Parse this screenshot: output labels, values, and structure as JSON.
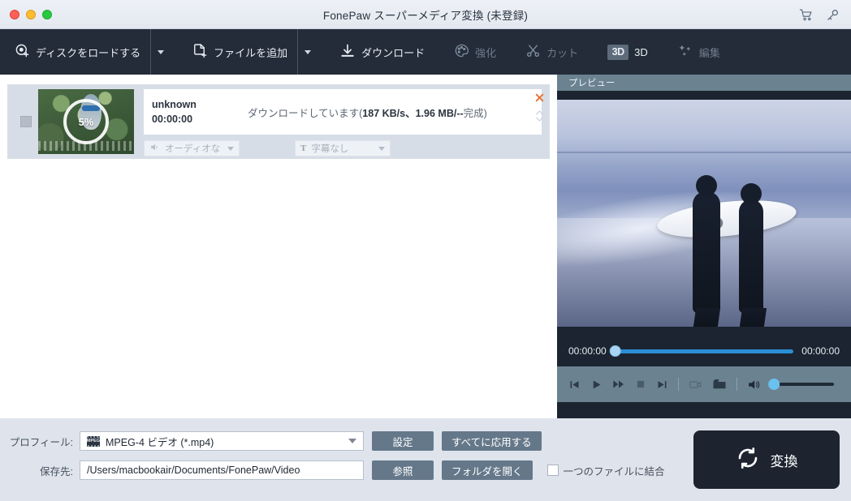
{
  "window": {
    "title": "FonePaw スーパーメディア変換 (未登録)",
    "controls": [
      "close",
      "minimize",
      "maximize"
    ],
    "right_icons": [
      "cart-icon",
      "key-icon"
    ]
  },
  "toolbar": {
    "items": [
      {
        "label": "ディスクをロードする",
        "icon": "load-disc-icon",
        "has_caret": true,
        "disabled": false
      },
      {
        "label": "ファイルを追加",
        "icon": "add-file-icon",
        "has_caret": true,
        "disabled": false
      },
      {
        "label": "ダウンロード",
        "icon": "download-icon",
        "has_caret": false,
        "disabled": false
      },
      {
        "label": "強化",
        "icon": "palette-icon",
        "has_caret": false,
        "disabled": true
      },
      {
        "label": "カット",
        "icon": "scissors-icon",
        "has_caret": false,
        "disabled": true
      },
      {
        "label": "3D",
        "icon": "3d-badge-icon",
        "has_caret": false,
        "disabled": false
      },
      {
        "label": "編集",
        "icon": "stars-icon",
        "has_caret": false,
        "disabled": true
      }
    ]
  },
  "task": {
    "progress_percent": "5%",
    "name": "unknown",
    "duration": "00:00:00",
    "status": "ダウンロードしています(187 KB/s、1.96 MB/--完成)",
    "status_plain": "ダウンロードしています(",
    "status_bold": "187 KB/s、1.96 MB/--",
    "status_tail": "完成)",
    "audio_track": "オーディオな",
    "subtitle_track": "字幕なし",
    "audio_icon": "speaker-icon",
    "subtitle_icon": "text-icon",
    "close_icon": "close-x-icon",
    "reorder_icon": "up-down-chevrons-icon"
  },
  "preview": {
    "header": "プレビュー",
    "current_time": "00:00:00",
    "total_time": "00:00:00",
    "seek_value": 0,
    "volume_value": 6,
    "controls": [
      "previous-icon",
      "play-icon",
      "fast-forward-icon",
      "stop-icon",
      "next-icon",
      "snapshot-icon",
      "open-folder-icon",
      "volume-icon"
    ]
  },
  "bottom": {
    "profile_label": "プロフィール:",
    "profile_value": "MPEG-4 ビデオ (*.mp4)",
    "profile_icon": "mpeg-file-icon",
    "settings_button": "設定",
    "apply_all_button": "すべてに応用する",
    "destination_label": "保存先:",
    "destination_value": "/Users/macbookair/Documents/FonePaw/Video",
    "browse_button": "参照",
    "open_folder_button": "フォルダを開く",
    "merge_checkbox_label": "一つのファイルに結合",
    "merge_checked": false,
    "convert_button": "変換",
    "convert_icon": "refresh-circle-icon"
  },
  "colors": {
    "titlebar": "#e7ecf3",
    "toolbar": "#232c38",
    "accent_blue": "#2b8fd6",
    "button_gray": "#65788a",
    "convert_dark": "#1d2430",
    "close_orange": "#e8702a",
    "preview_header": "#6b8291"
  }
}
